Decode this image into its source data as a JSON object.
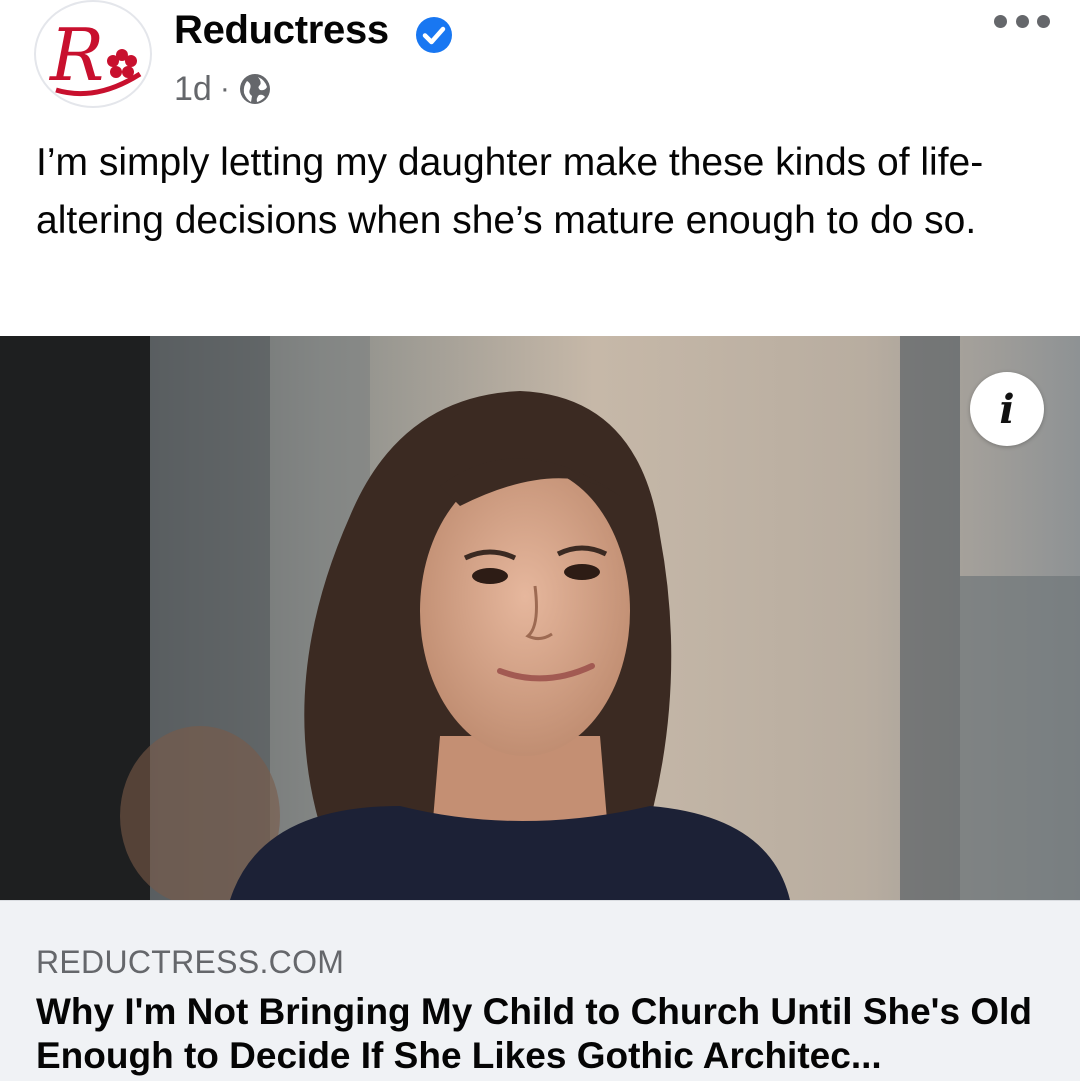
{
  "post": {
    "page_name": "Reductress",
    "verified": true,
    "timestamp": "1d",
    "separator": "·",
    "privacy_icon": "globe-icon",
    "more_icon": "more-dots-icon",
    "caption": "I’m simply letting my daughter make these kinds of life-altering decisions when she’s mature enough to do so.",
    "image": {
      "description_icon": "info-icon",
      "info_label": "i"
    },
    "link": {
      "domain": "REDUCTRESS.COM",
      "title": "Why I'm Not Bringing My Child to Church Until She's Old Enough to Decide If She Likes Gothic Architec..."
    }
  },
  "colors": {
    "brand_red": "#c8102e",
    "verified_blue": "#1877f2",
    "secondary_text": "#65676b",
    "link_background": "#f0f2f5"
  }
}
